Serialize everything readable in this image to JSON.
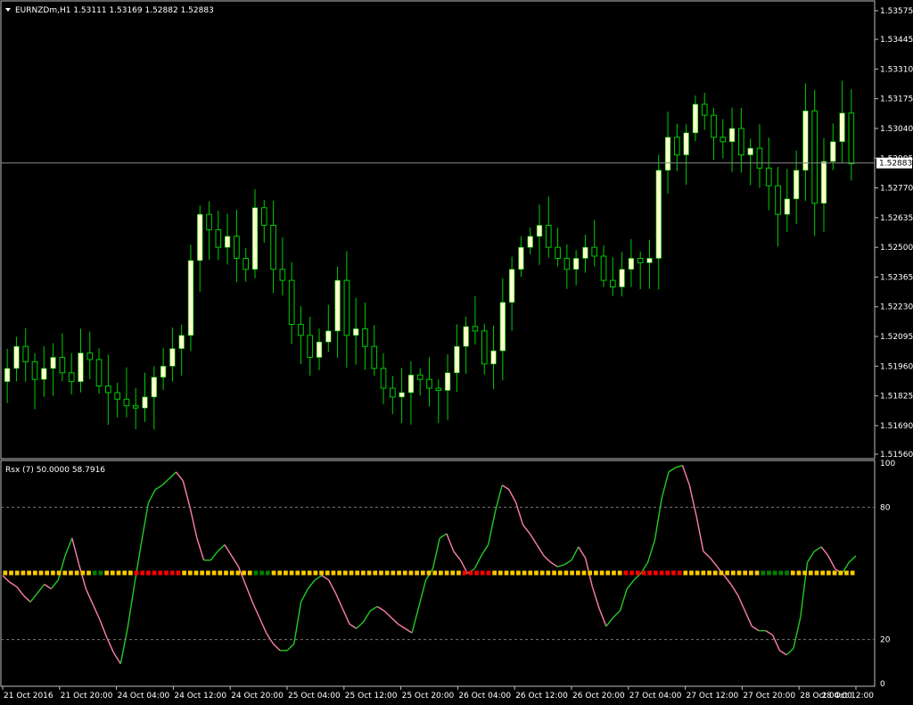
{
  "header": {
    "symbol_text": "EURNZDm,H1  1.53111 1.53169 1.52882 1.52883",
    "indicator_text": "Rsx (7) 50.0000 58.7916"
  },
  "colors": {
    "background": "#000000",
    "frame": "#c0c0c0",
    "bull_candle": "#ffffcc",
    "wick": "#00cc00",
    "rsx_up": "#22cc22",
    "rsx_down": "#ff7fb0",
    "dot_yellow": "#ffcc00",
    "dot_green": "#008000",
    "dot_red": "#ff0000"
  },
  "chart_data": [
    {
      "type": "candlestick",
      "symbol": "EURNZDm",
      "timeframe": "H1",
      "ohlc_last": {
        "open": 1.53111,
        "high": 1.53169,
        "low": 1.52882,
        "close": 1.52883
      },
      "current_price_label": "1.52883",
      "current_price": 1.52883,
      "y_ticks": [
        "1.53575",
        "1.53445",
        "1.53310",
        "1.53175",
        "1.53040",
        "1.52905",
        "1.52770",
        "1.52635",
        "1.52500",
        "1.52365",
        "1.52230",
        "1.52095",
        "1.51960",
        "1.51825",
        "1.51690",
        "1.51560"
      ],
      "ylim": [
        1.5156,
        1.53575
      ],
      "x_ticks": [
        "21 Oct 2016",
        "21 Oct 20:00",
        "24 Oct 04:00",
        "24 Oct 12:00",
        "24 Oct 20:00",
        "25 Oct 04:00",
        "25 Oct 12:00",
        "25 Oct 20:00",
        "26 Oct 04:00",
        "26 Oct 12:00",
        "26 Oct 20:00",
        "27 Oct 04:00",
        "27 Oct 12:00",
        "27 Oct 20:00",
        "28 Oct 04:00",
        "28 Oct 12:00"
      ],
      "closes": [
        1.5195,
        1.5205,
        1.5198,
        1.519,
        1.5195,
        1.52,
        1.5193,
        1.5189,
        1.5202,
        1.5199,
        1.5187,
        1.5184,
        1.5181,
        1.5178,
        1.5177,
        1.5182,
        1.5191,
        1.5196,
        1.5204,
        1.521,
        1.5244,
        1.5265,
        1.5258,
        1.525,
        1.5255,
        1.5245,
        1.524,
        1.5268,
        1.526,
        1.524,
        1.5235,
        1.5215,
        1.521,
        1.52,
        1.5207,
        1.5212,
        1.5235,
        1.521,
        1.5213,
        1.5205,
        1.5195,
        1.5186,
        1.5182,
        1.5184,
        1.5192,
        1.519,
        1.5186,
        1.5185,
        1.5193,
        1.5205,
        1.5214,
        1.5212,
        1.5197,
        1.5203,
        1.5225,
        1.524,
        1.525,
        1.5255,
        1.526,
        1.525,
        1.5245,
        1.524,
        1.5245,
        1.525,
        1.5246,
        1.5235,
        1.5232,
        1.524,
        1.5245,
        1.5243,
        1.5245,
        1.5285,
        1.53,
        1.5292,
        1.5302,
        1.5315,
        1.531,
        1.53,
        1.5298,
        1.5304,
        1.5292,
        1.5295,
        1.5286,
        1.5278,
        1.5265,
        1.5272,
        1.5285,
        1.5312,
        1.527,
        1.5289,
        1.5298,
        1.5311,
        1.5288
      ],
      "xlabel": "",
      "ylabel": ""
    },
    {
      "type": "line",
      "name": "Rsx (7)",
      "level_value": 50.0,
      "current_value": 58.7916,
      "y_ticks": [
        "100",
        "80",
        "20",
        "0"
      ],
      "ylim": [
        0,
        100
      ],
      "levels": [
        80,
        20
      ],
      "values": [
        49,
        46,
        44,
        40,
        37,
        41,
        45,
        43,
        47,
        58,
        66,
        54,
        43,
        36,
        29,
        21,
        14,
        9,
        25,
        45,
        64,
        82,
        88,
        90,
        93,
        96,
        92,
        80,
        66,
        56,
        56,
        60,
        63,
        58,
        53,
        45,
        37,
        30,
        23,
        18,
        15,
        15,
        18,
        37,
        43,
        47,
        49,
        47,
        41,
        34,
        27,
        25,
        28,
        33,
        35,
        33,
        30,
        27,
        25,
        23,
        35,
        47,
        52,
        66,
        68,
        60,
        56,
        50,
        52,
        58,
        63,
        78,
        90,
        88,
        82,
        72,
        68,
        63,
        58,
        55,
        53,
        54,
        56,
        62,
        57,
        44,
        34,
        26,
        30,
        33,
        43,
        47,
        50,
        55,
        65,
        84,
        96,
        98,
        99,
        90,
        76,
        60,
        57,
        53,
        49,
        45,
        40,
        33,
        26,
        24,
        24,
        22,
        15,
        13,
        16,
        30,
        55,
        60,
        62,
        58,
        52,
        50,
        55,
        58
      ],
      "signal_dots": [
        "y",
        "y",
        "y",
        "y",
        "y",
        "y",
        "y",
        "y",
        "y",
        "y",
        "y",
        "y",
        "y",
        "y",
        "y",
        "g",
        "g",
        "y",
        "y",
        "y",
        "y",
        "y",
        "r",
        "r",
        "r",
        "r",
        "r",
        "r",
        "r",
        "r",
        "y",
        "y",
        "y",
        "y",
        "y",
        "y",
        "y",
        "y",
        "y",
        "y",
        "y",
        "y",
        "g",
        "g",
        "g",
        "y",
        "y",
        "y",
        "y",
        "y",
        "y",
        "y",
        "y",
        "y",
        "y",
        "y",
        "y",
        "y",
        "y",
        "y",
        "y",
        "y",
        "y",
        "y",
        "y",
        "y",
        "y",
        "y",
        "y",
        "y",
        "y",
        "y",
        "y",
        "y",
        "y",
        "y",
        "y",
        "r",
        "r",
        "r",
        "r",
        "r",
        "y",
        "y",
        "y",
        "y",
        "y",
        "y",
        "y",
        "y",
        "y",
        "y",
        "y",
        "y",
        "y",
        "y",
        "y",
        "y",
        "y",
        "y",
        "y",
        "y",
        "y",
        "y",
        "r",
        "r",
        "r",
        "r",
        "r",
        "r",
        "r",
        "r",
        "r",
        "r",
        "y",
        "y",
        "y",
        "y",
        "y",
        "y",
        "y",
        "y",
        "y",
        "y",
        "y",
        "y",
        "y",
        "g",
        "g",
        "g",
        "g",
        "g",
        "y",
        "y",
        "y",
        "y",
        "y",
        "y",
        "y",
        "y",
        "y",
        "y",
        "y"
      ]
    }
  ]
}
